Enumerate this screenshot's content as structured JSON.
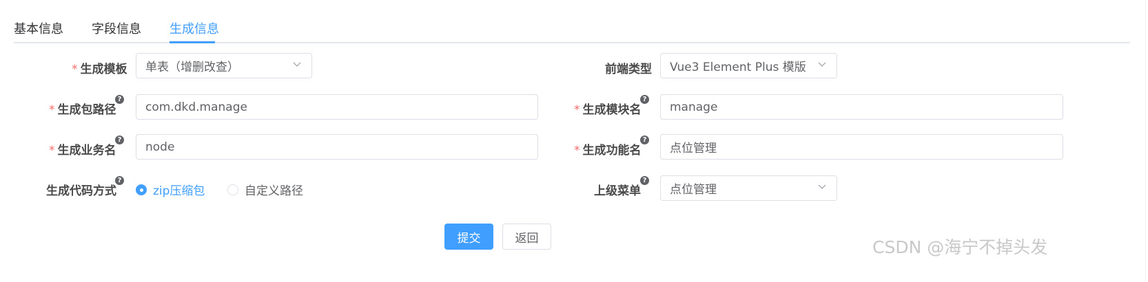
{
  "tabs": [
    {
      "label": "基本信息",
      "active": false
    },
    {
      "label": "字段信息",
      "active": false
    },
    {
      "label": "生成信息",
      "active": true
    }
  ],
  "form": {
    "tpl_category": {
      "label": "生成模板",
      "required": true,
      "value": "单表（增删改查）"
    },
    "frontend_type": {
      "label": "前端类型",
      "required": false,
      "value": "Vue3 Element Plus 模版"
    },
    "package_name": {
      "label": "生成包路径",
      "required": true,
      "help": "?",
      "value": "com.dkd.manage"
    },
    "module_name": {
      "label": "生成模块名",
      "required": true,
      "help": "?",
      "value": "manage"
    },
    "business_name": {
      "label": "生成业务名",
      "required": true,
      "help": "?",
      "value": "node"
    },
    "function_name": {
      "label": "生成功能名",
      "required": true,
      "help": "?",
      "value": "点位管理"
    },
    "gen_type": {
      "label": "生成代码方式",
      "help": "?",
      "options": [
        {
          "label": "zip压缩包",
          "checked": true
        },
        {
          "label": "自定义路径",
          "checked": false
        }
      ]
    },
    "parent_menu": {
      "label": "上级菜单",
      "help": "?",
      "value": "点位管理"
    }
  },
  "actions": {
    "submit": "提交",
    "back": "返回"
  },
  "required_mark": "*",
  "watermark": "CSDN @海宁不掉头发",
  "colors": {
    "primary": "#409eff",
    "required": "#f56c6c",
    "border": "#dcdfe6",
    "text": "#606266"
  }
}
